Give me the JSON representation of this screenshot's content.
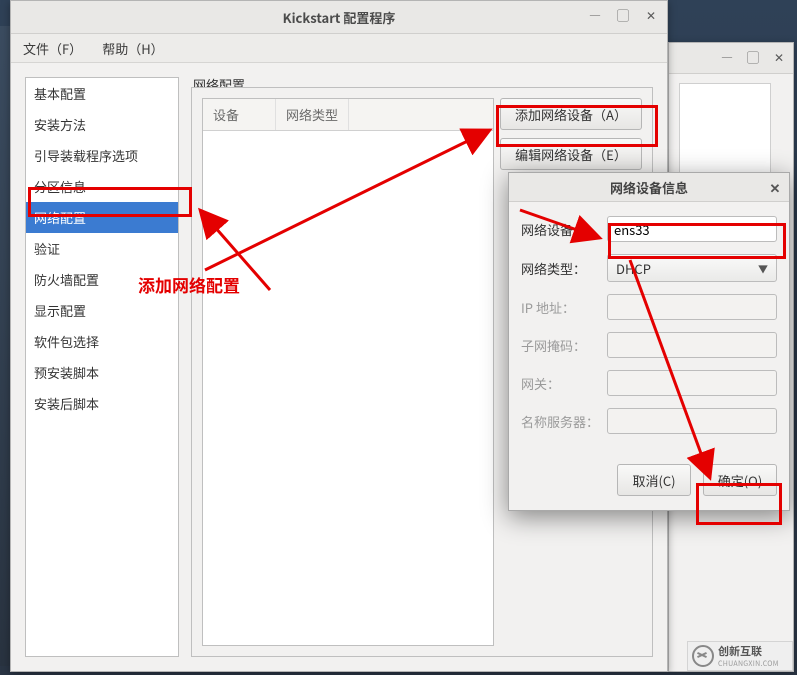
{
  "main_window": {
    "title": "Kickstart 配置程序",
    "menu": {
      "file": "文件（F）",
      "help": "帮助（H）"
    },
    "sidebar": {
      "items": [
        {
          "label": "基本配置"
        },
        {
          "label": "安装方法"
        },
        {
          "label": "引导装载程序选项"
        },
        {
          "label": "分区信息"
        },
        {
          "label": "网络配置",
          "selected": true
        },
        {
          "label": "验证"
        },
        {
          "label": "防火墙配置"
        },
        {
          "label": "显示配置"
        },
        {
          "label": "软件包选择"
        },
        {
          "label": "预安装脚本"
        },
        {
          "label": "安装后脚本"
        }
      ]
    },
    "panel_title": "网络配置",
    "table_headers": {
      "col1": "设备",
      "col2": "网络类型"
    },
    "buttons": {
      "add": "添加网络设备（A）",
      "edit": "编辑网络设备（E）"
    }
  },
  "dialog": {
    "title": "网络设备信息",
    "fields": {
      "device_label": "网络设备：",
      "device_value": "ens33",
      "type_label": "网络类型：",
      "type_value": "DHCP",
      "ip_label": "IP 地址：",
      "netmask_label": "子网掩码：",
      "gateway_label": "网关：",
      "nameserver_label": "名称服务器："
    },
    "buttons": {
      "cancel": "取消(C)",
      "ok": "确定(O)"
    }
  },
  "annotation": {
    "text": "添加网络配置"
  },
  "watermark": {
    "brand": "创新互联",
    "sub": "CHUANGXIN.COM"
  }
}
